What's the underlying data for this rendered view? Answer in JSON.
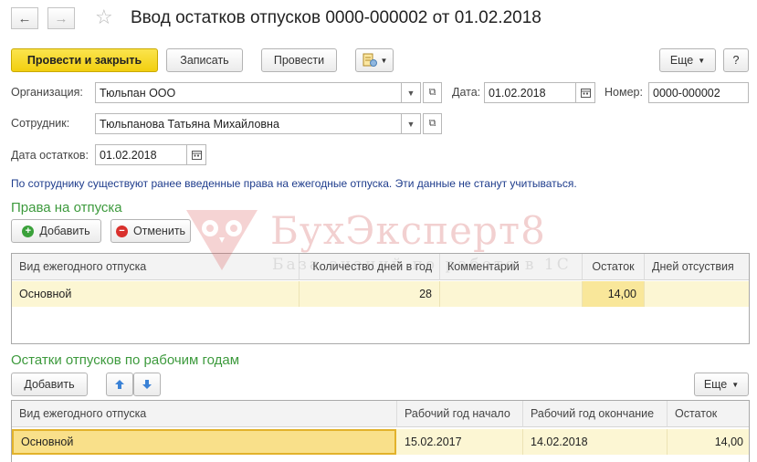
{
  "header": {
    "back_icon": "←",
    "forward_icon": "→",
    "favorite_icon": "☆",
    "title": "Ввод остатков отпусков 0000-000002 от 01.02.2018"
  },
  "toolbar": {
    "post_close_label": "Провести и закрыть",
    "save_label": "Записать",
    "post_label": "Провести",
    "more_label": "Еще",
    "help_label": "?"
  },
  "form": {
    "org_label": "Организация:",
    "org_value": "Тюльпан ООО",
    "date_label": "Дата:",
    "date_value": "01.02.2018",
    "number_label": "Номер:",
    "number_value": "0000-000002",
    "employee_label": "Сотрудник:",
    "employee_value": "Тюльпанова Татьяна Михайловна",
    "balance_date_label": "Дата остатков:",
    "balance_date_value": "01.02.2018"
  },
  "info_text": "По сотруднику существуют ранее введенные права на ежегодные отпуска. Эти данные не станут учитываться.",
  "rights": {
    "title": "Права на отпуска",
    "add_label": "Добавить",
    "cancel_label": "Отменить",
    "columns": [
      "Вид ежегодного отпуска",
      "Количество дней в год",
      "Комментарий",
      "Остаток",
      "Дней отсуствия"
    ],
    "rows": [
      {
        "type": "Основной",
        "days": "28",
        "comment": "",
        "balance": "14,00",
        "absent": ""
      }
    ]
  },
  "balances": {
    "title": "Остатки отпусков по рабочим годам",
    "add_label": "Добавить",
    "more_label": "Еще",
    "columns": [
      "Вид ежегодного отпуска",
      "Рабочий год начало",
      "Рабочий год окончание",
      "Остаток"
    ],
    "rows": [
      {
        "type": "Основной",
        "start": "15.02.2017",
        "end": "14.02.2018",
        "balance": "14,00"
      }
    ]
  },
  "watermark": {
    "text": "БухЭксперт8",
    "subtext": "База знаний по работе в 1С"
  },
  "colors": {
    "primary_button": "#f2cf0f",
    "section_title": "#3d9a3d",
    "info_text": "#1e3c8c",
    "selected_row": "#fcf6d3"
  }
}
